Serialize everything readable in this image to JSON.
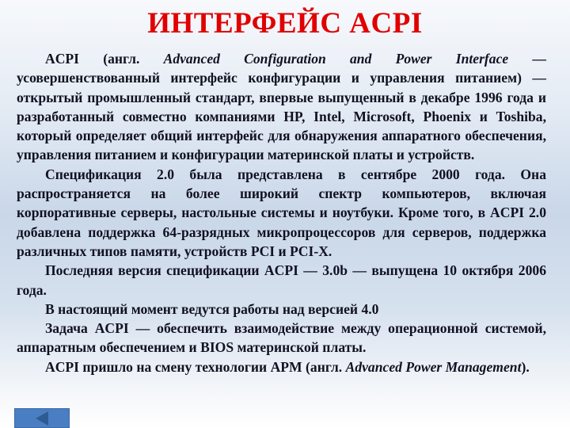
{
  "slide": {
    "title": "ИНТЕРФЕЙС ACPI",
    "paragraphs": [
      {
        "parts": [
          {
            "text": "ACPI (англ. ",
            "italic": false
          },
          {
            "text": "Advanced Configuration and Power Interface",
            "italic": true
          },
          {
            "text": " — усовершенствованный интерфейс конфигурации и управления питанием) — открытый промышленный стандарт, впервые выпущенный в декабре 1996 года и разработанный совместно компаниями HP, Intel, Microsoft, Phoenix и Toshiba, который определяет общий интерфейс для обнаружения аппаратного обеспечения, управления питанием и конфигурации материнской платы и устройств.",
            "italic": false
          }
        ]
      },
      {
        "parts": [
          {
            "text": "Спецификация 2.0 была представлена в сентябре 2000 года. Она распространяется на более широкий спектр компьютеров, включая корпоративные серверы, настольные системы и ноутбуки. Кроме того, в ACPI 2.0 добавлена поддержка 64-разрядных микропроцессоров для серверов, поддержка различных типов памяти, устройств PCI и PCI-X.",
            "italic": false
          }
        ]
      },
      {
        "parts": [
          {
            "text": "Последняя версия спецификации ACPI — 3.0b — выпущена 10 октября 2006 года.",
            "italic": false
          }
        ]
      },
      {
        "parts": [
          {
            "text": "В настоящий момент ведутся работы над версией 4.0",
            "italic": false
          }
        ]
      },
      {
        "parts": [
          {
            "text": "Задача ACPI — обеспечить взаимодействие между операционной системой, аппаратным обеспечением и BIOS материнской платы.",
            "italic": false
          }
        ]
      },
      {
        "parts": [
          {
            "text": "ACPI пришло на смену технологии APM (англ. ",
            "italic": false
          },
          {
            "text": "Advanced Power Management",
            "italic": true
          },
          {
            "text": ").",
            "italic": false
          }
        ]
      }
    ]
  },
  "navigation": {
    "back_icon": "triangle-left-icon"
  },
  "colors": {
    "title": "#e00000",
    "text": "#111122",
    "nav_button": "#4a7ec3"
  }
}
